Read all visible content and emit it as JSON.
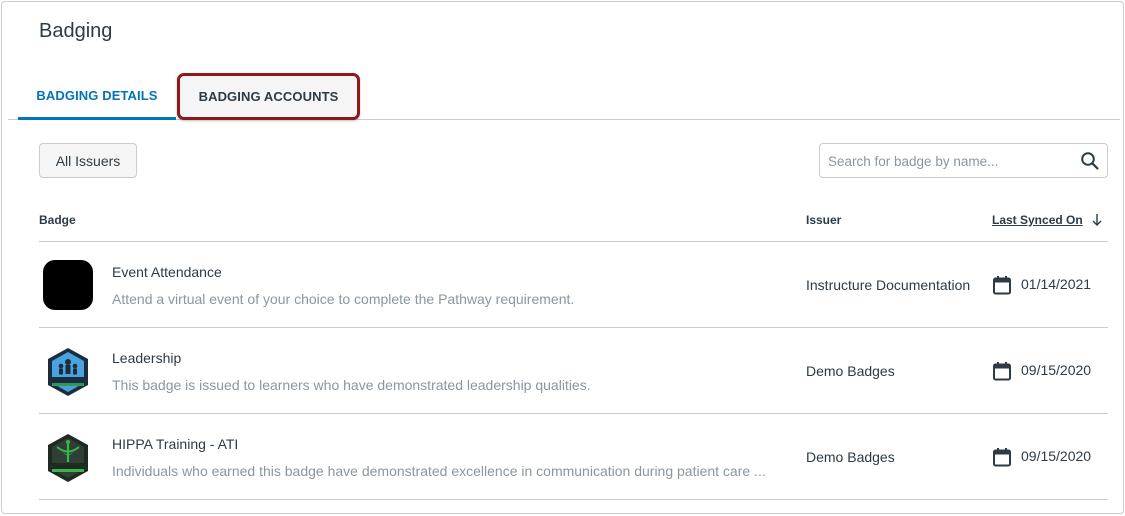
{
  "page": {
    "title": "Badging"
  },
  "tabs": [
    {
      "label": "BADGING DETAILS",
      "active": true
    },
    {
      "label": "BADGING ACCOUNTS",
      "active": false,
      "highlighted": true
    }
  ],
  "filters": {
    "issuers_label": "All Issuers"
  },
  "search": {
    "placeholder": "Search for badge by name...",
    "icon": "search-icon"
  },
  "table": {
    "columns": {
      "badge": "Badge",
      "issuer": "Issuer",
      "last_synced": "Last Synced On"
    },
    "sort": {
      "column": "last_synced",
      "direction": "descending",
      "icon": "arrow-down-icon"
    },
    "rows": [
      {
        "name": "Event Attendance",
        "description": "Attend a virtual event of your choice to complete the Pathway requirement.",
        "issuer": "Instructure Documentation",
        "date": "01/14/2021",
        "image": "black-rounded-square-badge"
      },
      {
        "name": "Leadership",
        "description": "This badge is issued to learners who have demonstrated leadership qualities.",
        "issuer": "Demo Badges",
        "date": "09/15/2020",
        "image": "leadership-hexagon-badge"
      },
      {
        "name": "HIPPA Training - ATI",
        "description": "Individuals who earned this badge have demonstrated excellence in communication during patient care ...",
        "issuer": "Demo Badges",
        "date": "09/15/2020",
        "image": "hipaa-hexagon-badge"
      }
    ]
  },
  "colors": {
    "accent": "#0374b5",
    "text": "#2d3b45",
    "muted": "#8b969e",
    "border": "#c7cdd1",
    "highlight_outline": "#8b1a1a"
  }
}
